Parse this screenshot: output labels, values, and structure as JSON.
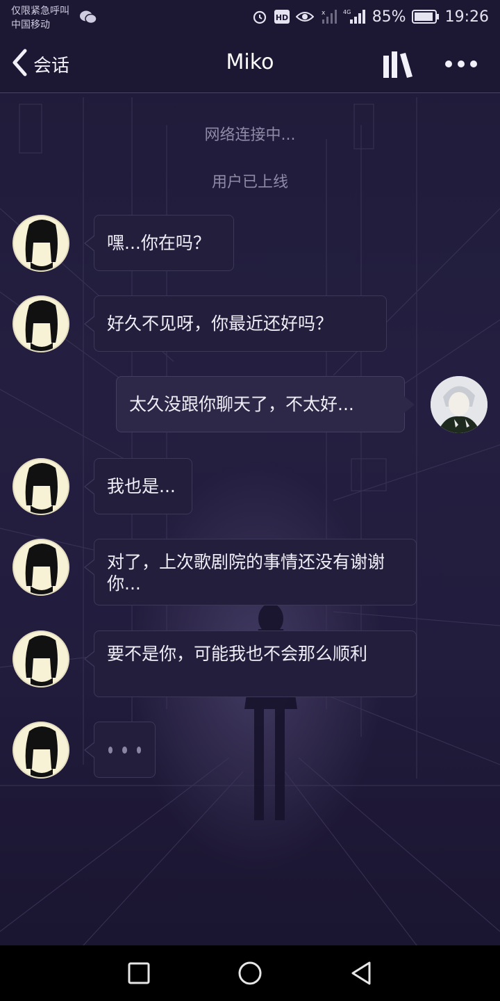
{
  "status_bar": {
    "carrier_line1": "仅限紧急呼叫",
    "carrier_line2": "中国移动",
    "network": "4G",
    "battery": "85%",
    "time": "19:26"
  },
  "header": {
    "back_label": "会话",
    "title": "Miko",
    "icons": [
      "library-icon",
      "more-icon"
    ]
  },
  "system_messages": [
    "网络连接中...",
    "用户已上线"
  ],
  "messages": [
    {
      "sender": "Miko",
      "side": "left",
      "text": "嘿...你在吗？"
    },
    {
      "sender": "Miko",
      "side": "left",
      "text": "好久不见呀，你最近还好吗？"
    },
    {
      "sender": "me",
      "side": "right",
      "text": "太久没跟你聊天了，不太好..."
    },
    {
      "sender": "Miko",
      "side": "left",
      "text": "我也是..."
    },
    {
      "sender": "Miko",
      "side": "left",
      "text": "对了，上次歌剧院的事情还没有谢谢你..."
    },
    {
      "sender": "Miko",
      "side": "left",
      "text": "要不是你，可能我也不会那么顺利"
    },
    {
      "sender": "Miko",
      "side": "left",
      "typing": true
    }
  ],
  "colors": {
    "background": "#1b1630",
    "bubble": "#241e3d",
    "bubble_border": "#3d3758",
    "system_text": "#8f8aa6",
    "avatar_bg": "#f7f1d6"
  }
}
